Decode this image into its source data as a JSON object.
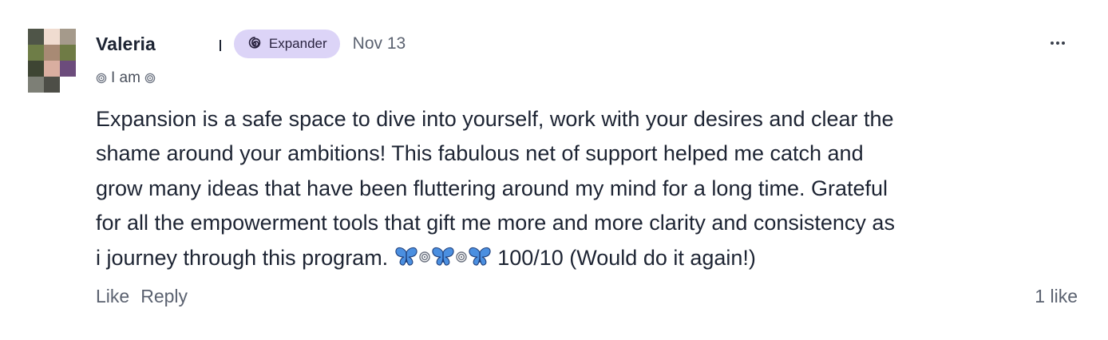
{
  "comment": {
    "author": {
      "name": "Valeria",
      "avatar_icon": "pixelated-avatar"
    },
    "badge": {
      "label": "Expander",
      "icon": "spiral-icon",
      "color": "#dcd4f7"
    },
    "timestamp": "Nov 13",
    "subtitle": "I am",
    "body": {
      "text": "Expansion is a safe space to dive into yourself, work with your desires and clear the\nshame around your ambitions! This fabulous net of support helped me catch and\ngrow many ideas that have been fluttering around my mind for a long time. Grateful\nfor all the empowerment tools that gift me more and more clarity and consistency as\ni journey through this program. ",
      "emoji_sequence": [
        "butterfly",
        "spiral",
        "butterfly",
        "spiral",
        "butterfly"
      ],
      "text_after_emoji": " 100/10 (Would do it again!)"
    },
    "actions": {
      "like_label": "Like",
      "reply_label": "Reply"
    },
    "like_count": "1 like",
    "more_menu_icon": "ellipsis-icon"
  }
}
